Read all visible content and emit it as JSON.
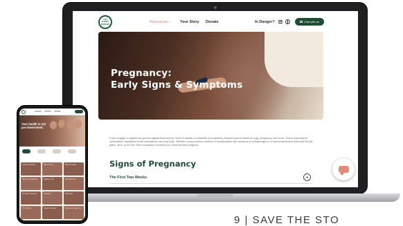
{
  "site": {
    "logo_text": "YOU EVERY WOMAN"
  },
  "nav": {
    "resources_label": "Resources ›",
    "story_label": "Your Story",
    "donate_label": "Donate",
    "danger_label": "In Danger?",
    "menu_icon": "menu-icon",
    "globe_icon": "globe-icon",
    "chat_label": "Chat with us"
  },
  "hero": {
    "title_line1": "Pregnancy:",
    "title_line2": "Early Signs & Symptoms"
  },
  "article": {
    "intro": "If you engage in vaginal sex (penal-vaginal intercourse), there is always a possibility of pregnancy. Anytime sperm meets an egg, pregnancy can occur. This is important to understand, regardless of the precautions you may take. Whether using a barrier method of contraception like condoms or a diaphragm or a hormonal/medical form like the pill, patch, shot, or an IUD, there is always a chance you could become pregnant.",
    "section_title": "Signs of Pregnancy",
    "subsection_title": "The First Two Weeks",
    "expand_symbol": "+"
  },
  "phone": {
    "hero_title": "Your health is not pre-determined.",
    "cards": [
      "Labor & Delivery",
      "Birth Control",
      "Mental Health",
      "Signs of Pregnancy",
      "Abortion Info",
      "Prenatal Care",
      "Domestic Violence",
      "Adoption",
      "Parenting",
      "STI Testing",
      "Support Groups",
      "Resources Near You"
    ]
  },
  "caption": {
    "text": "9 | SAVE THE STO"
  },
  "colors": {
    "brand_green": "#1f4d34",
    "accent_coral": "#e48a7b",
    "card_brown": "#8a5d4f"
  }
}
